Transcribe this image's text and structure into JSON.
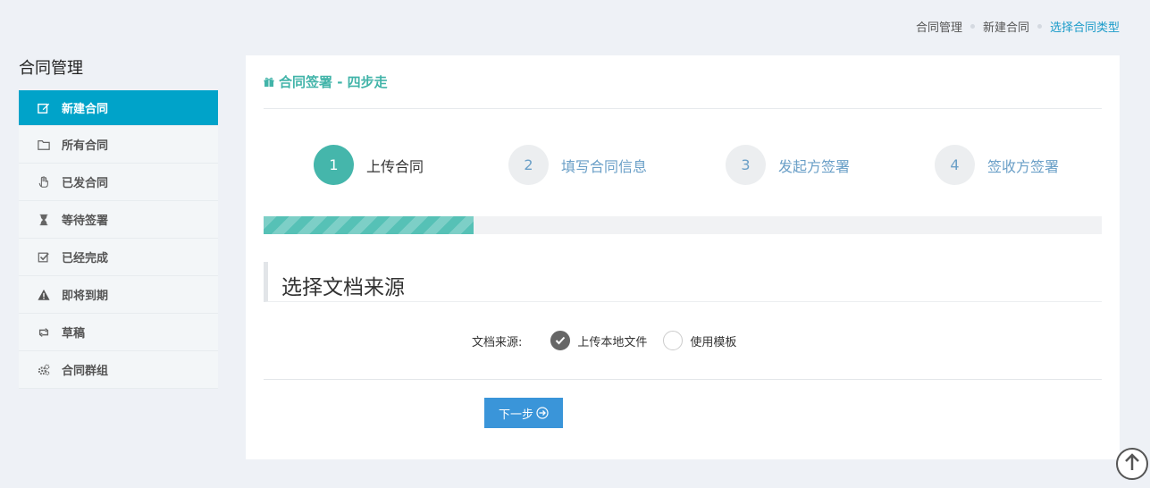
{
  "breadcrumb": [
    "合同管理",
    "新建合同",
    "选择合同类型"
  ],
  "sidebar": {
    "title": "合同管理",
    "items": [
      {
        "label": "新建合同",
        "icon": "edit-icon",
        "active": true
      },
      {
        "label": "所有合同",
        "icon": "folder-icon"
      },
      {
        "label": "已发合同",
        "icon": "hand-icon"
      },
      {
        "label": "等待签署",
        "icon": "hourglass-icon"
      },
      {
        "label": "已经完成",
        "icon": "check-square-icon"
      },
      {
        "label": "即将到期",
        "icon": "warning-icon"
      },
      {
        "label": "草稿",
        "icon": "retweet-icon"
      },
      {
        "label": "合同群组",
        "icon": "cogs-icon"
      }
    ]
  },
  "panel": {
    "title": "合同签署 - 四步走",
    "title_icon": "gift-icon",
    "steps": [
      {
        "num": "1",
        "label": "上传合同",
        "done": true
      },
      {
        "num": "2",
        "label": "填写合同信息"
      },
      {
        "num": "3",
        "label": "发起方签署"
      },
      {
        "num": "4",
        "label": "签收方签署"
      }
    ],
    "progress": 0.25,
    "section_title": "选择文档来源",
    "form": {
      "label": "文档来源:",
      "options": [
        {
          "label": "上传本地文件",
          "checked": true
        },
        {
          "label": "使用模板",
          "checked": false
        }
      ]
    },
    "next_label": "下一步"
  },
  "colors": {
    "accent": "#00a3c9",
    "teal": "#45b6ab",
    "button": "#3a95d9"
  }
}
